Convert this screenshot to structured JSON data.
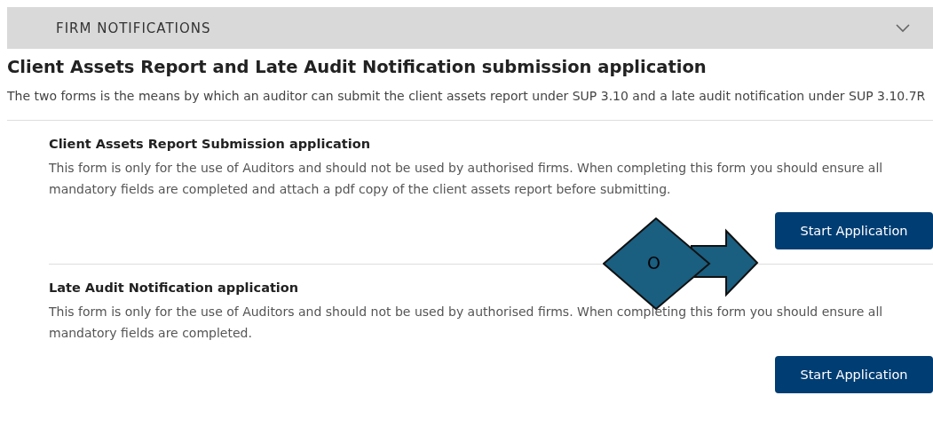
{
  "panel": {
    "title": "FIRM NOTIFICATIONS",
    "expanded": true
  },
  "heading": "Client Assets Report and Late Audit Notification submission application",
  "intro": "The two forms is the means by which an auditor can submit the client assets report under SUP 3.10 and a late audit notification under SUP 3.10.7R",
  "sections": [
    {
      "title": "Client Assets Report Submission application",
      "text": "This form is only for the use of Auditors and should not be used by authorised firms. When completing this form you should ensure all mandatory fields are completed and attach a pdf copy of the client assets report before submitting.",
      "button": "Start Application"
    },
    {
      "title": "Late Audit Notification application",
      "text": "This form is only for the use of Auditors and should not be used by authorised firms. When completing this form you should ensure all mandatory fields are completed.",
      "button": "Start Application"
    }
  ],
  "annotation": {
    "label": "O"
  }
}
